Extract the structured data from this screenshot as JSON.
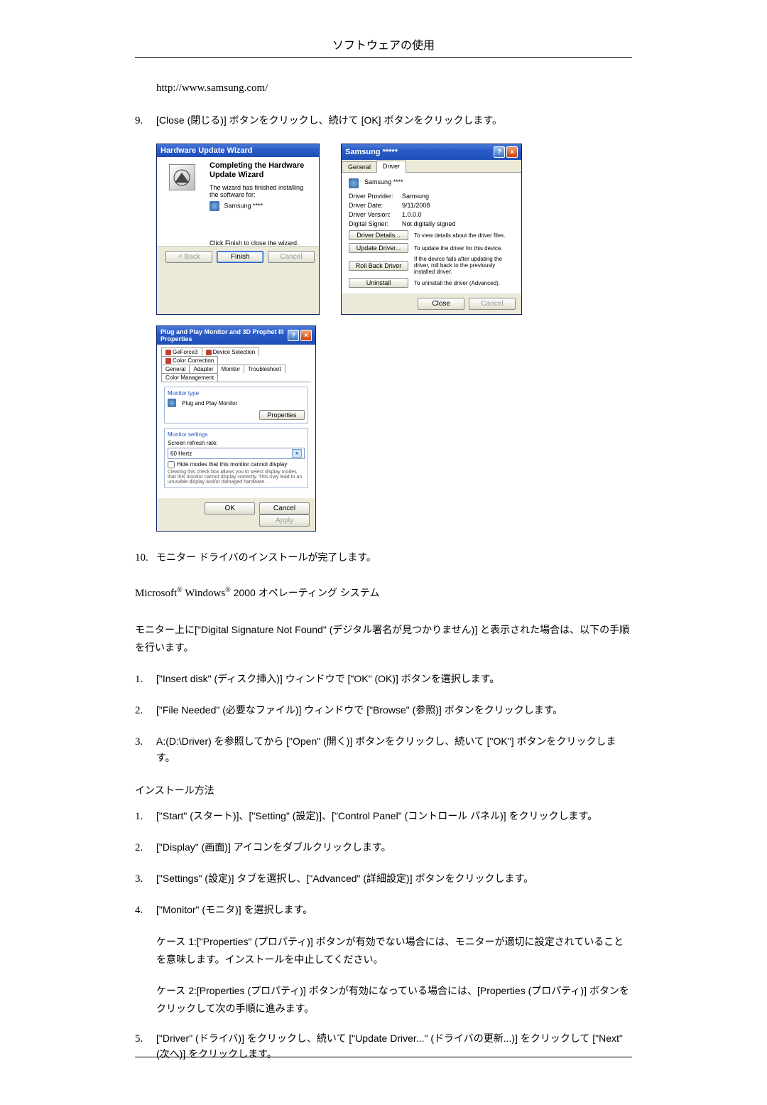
{
  "header": {
    "title": "ソフトウェアの使用"
  },
  "url": "http://www.samsung.com/",
  "step9": {
    "num": "9.",
    "text": "[Close (閉じる)] ボタンをクリックし、続けて [OK] ボタンをクリックします。"
  },
  "wizard": {
    "title": "Hardware Update Wizard",
    "heading": "Completing the Hardware Update Wizard",
    "desc": "The wizard has finished installing the software for:",
    "item": "Samsung ****",
    "finish_hint": "Click Finish to close the wizard.",
    "buttons": {
      "back": "< Back",
      "finish": "Finish",
      "cancel": "Cancel"
    }
  },
  "props": {
    "title": "Samsung *****",
    "tabs": {
      "general": "General",
      "driver": "Driver"
    },
    "device_name": "Samsung ****",
    "fields": {
      "provider_k": "Driver Provider:",
      "provider_v": "Samsung",
      "date_k": "Driver Date:",
      "date_v": "9/11/2008",
      "version_k": "Driver Version:",
      "version_v": "1.0.0.0",
      "signer_k": "Digital Signer:",
      "signer_v": "Not digitally signed"
    },
    "rows": {
      "details_btn": "Driver Details...",
      "details_desc": "To view details about the driver files.",
      "update_btn": "Update Driver...",
      "update_desc": "To update the driver for this device.",
      "rollback_btn": "Roll Back Driver",
      "rollback_desc": "If the device fails after updating the driver, roll back to the previously installed driver.",
      "uninstall_btn": "Uninstall",
      "uninstall_desc": "To uninstall the driver (Advanced)."
    },
    "close": "Close",
    "cancel": "Cancel"
  },
  "pnp": {
    "title": "Plug and Play Monitor and 3D Prophet III Properties",
    "tabs": {
      "geforce": "GeForce3",
      "devsel": "Device Selection",
      "colorcorr": "Color Correction",
      "general": "General",
      "adapter": "Adapter",
      "monitor": "Monitor",
      "troubleshoot": "Troubleshoot",
      "colormgmt": "Color Management"
    },
    "monitor_type": "Monitor type",
    "monitor_name": "Plug and Play Monitor",
    "properties_btn": "Properties",
    "monitor_settings": "Monitor settings",
    "refresh_label": "Screen refresh rate:",
    "refresh_value": "60 Hertz",
    "hide_modes": "Hide modes that this monitor cannot display",
    "hide_desc": "Clearing this check box allows you to select display modes that this monitor cannot display correctly. This may lead to an unusable display and/or damaged hardware.",
    "ok": "OK",
    "cancel": "Cancel",
    "apply": "Apply"
  },
  "step10": {
    "num": "10.",
    "text": "モニター ドライバのインストールが完了します。"
  },
  "os_line": {
    "prefix": "Microsoft",
    "reg1": "®",
    "mid": " Windows",
    "reg2": "®",
    "suffix": " 2000 オペレーティング システム"
  },
  "dsig_para": "モニター上に[\"Digital Signature Not Found\" (デジタル署名が見つかりません)] と表示された場合は、以下の手順を行います。",
  "listA": {
    "i1": {
      "num": "1.",
      "text": "[\"Insert disk\" (ディスク挿入)] ウィンドウで [\"OK\" (OK)] ボタンを選択します。"
    },
    "i2": {
      "num": "2.",
      "text": "[\"File Needed\" (必要なファイル)] ウィンドウで [\"Browse\" (参照)] ボタンをクリックします。"
    },
    "i3": {
      "num": "3.",
      "text": "A:(D:\\Driver) を参照してから [\"Open\" (開く)] ボタンをクリックし、続いて [\"OK\"] ボタンをクリックします。"
    }
  },
  "install_heading": "インストール方法",
  "listB": {
    "i1": {
      "num": "1.",
      "text": "[\"Start\" (スタート)]、[\"Setting\" (設定)]、[\"Control Panel\" (コントロール パネル)] をクリックします。"
    },
    "i2": {
      "num": "2.",
      "text": "[\"Display\" (画面)] アイコンをダブルクリックします。"
    },
    "i3": {
      "num": "3.",
      "text": "[\"Settings\" (設定)] タブを選択し、[\"Advanced\" (詳細設定)] ボタンをクリックします。"
    },
    "i4": {
      "num": "4.",
      "text": "[\"Monitor\" (モニタ)] を選択します。"
    },
    "i4_case1": "ケース 1:[\"Properties\" (プロパティ)] ボタンが有効でない場合には、モニターが適切に設定されていることを意味します。インストールを中止してください。",
    "i4_case2": "ケース 2:[Properties (プロパティ)] ボタンが有効になっている場合には、[Properties (プロパティ)] ボタンをクリックして次の手順に進みます。",
    "i5": {
      "num": "5.",
      "text": "[\"Driver\" (ドライバ)] をクリックし、続いて [\"Update Driver...\" (ドライバの更新...)] をクリックして [\"Next\" (次へ)] をクリックします。"
    }
  }
}
